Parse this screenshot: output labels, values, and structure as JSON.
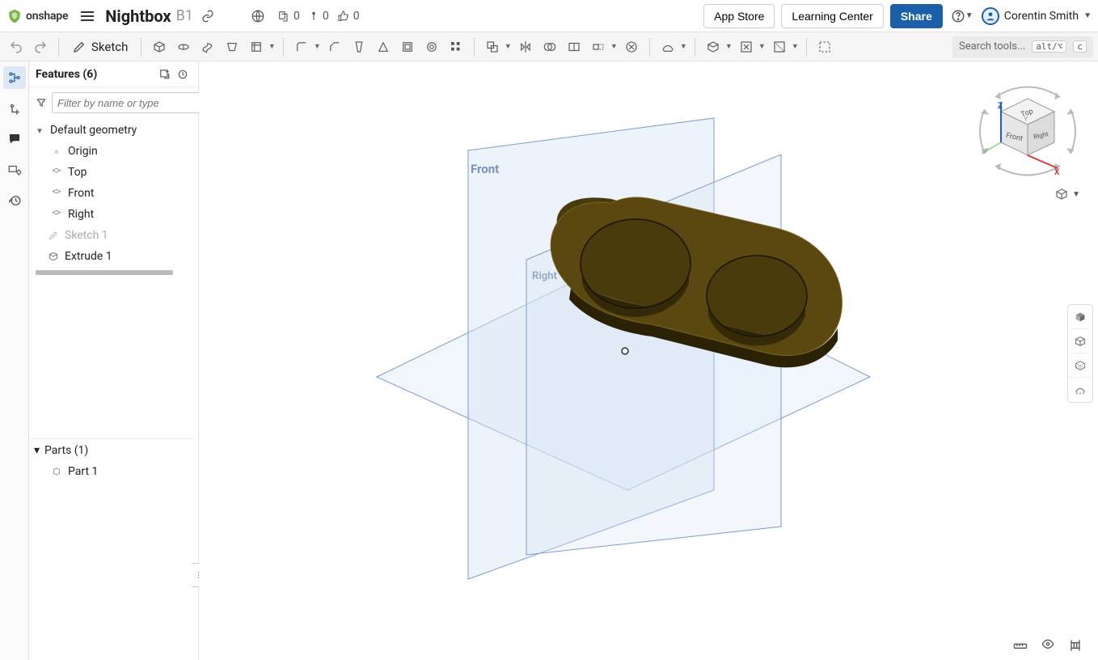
{
  "brand": "onshape",
  "document": {
    "title": "Nightbox",
    "branch": "B1"
  },
  "header": {
    "stats": {
      "versions": "0",
      "comments": "0",
      "likes": "0"
    },
    "buttons": {
      "app_store": "App Store",
      "learning_center": "Learning Center",
      "share": "Share"
    },
    "user_name": "Corentin Smith"
  },
  "toolbar": {
    "sketch_label": "Sketch",
    "search_placeholder": "Search tools...",
    "search_kbd1": "alt/⌥",
    "search_kbd2": "c"
  },
  "features_panel": {
    "title": "Features (6)",
    "filter_placeholder": "Filter by name or type",
    "default_geometry_label": "Default geometry",
    "items": {
      "origin": "Origin",
      "top": "Top",
      "front": "Front",
      "right": "Right",
      "sketch1": "Sketch 1",
      "extrude1": "Extrude 1"
    },
    "parts_title": "Parts (1)",
    "part1": "Part 1"
  },
  "viewport": {
    "plane_labels": {
      "front": "Front",
      "right": "Right"
    },
    "axes": {
      "x": "X",
      "y": "Y",
      "z": "Z",
      "top": "Top",
      "front": "Front",
      "right": "Right"
    }
  }
}
